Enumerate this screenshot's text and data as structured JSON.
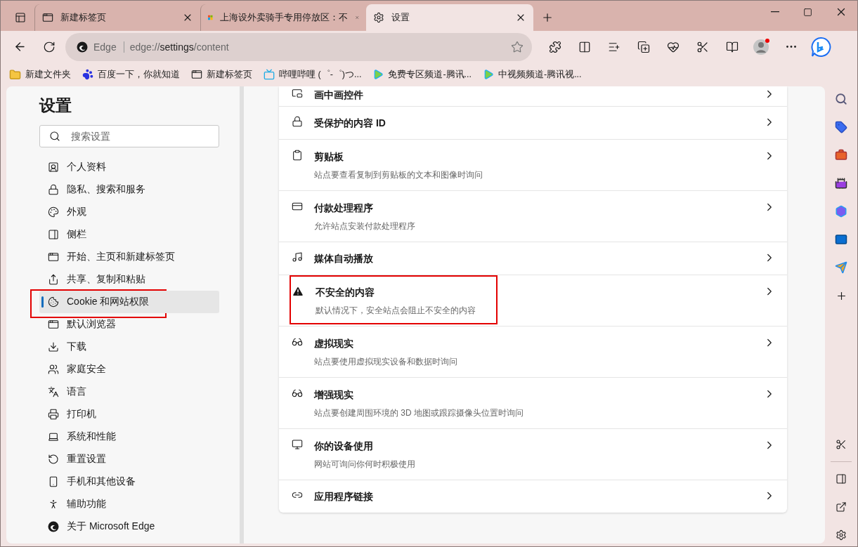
{
  "tabs": [
    {
      "label": "新建标签页",
      "selected": false
    },
    {
      "label": "上海设外卖骑手专用停放区：不",
      "selected": false
    },
    {
      "label": "设置",
      "selected": true
    }
  ],
  "address": {
    "site_label": "Edge",
    "url": "edge://**settings**/content"
  },
  "bookmarks": [
    {
      "label": "新建文件夹",
      "kind": "folder"
    },
    {
      "label": "百度一下，你就知道",
      "kind": "paw"
    },
    {
      "label": "新建标签页",
      "kind": "newtab"
    },
    {
      "label": "哔哩哔哩 (゜-゜)つ...",
      "kind": "tv"
    },
    {
      "label": "免费专区频道-腾讯...",
      "kind": "play"
    },
    {
      "label": "中视频频道-腾讯视...",
      "kind": "play"
    }
  ],
  "settings_title": "设置",
  "search": {
    "placeholder": "搜索设置"
  },
  "nav": [
    {
      "label": "个人资料",
      "selected": false,
      "highlighted": false
    },
    {
      "label": "隐私、搜索和服务",
      "selected": false,
      "highlighted": false
    },
    {
      "label": "外观",
      "selected": false,
      "highlighted": false
    },
    {
      "label": "侧栏",
      "selected": false,
      "highlighted": false
    },
    {
      "label": "开始、主页和新建标签页",
      "selected": false,
      "highlighted": false
    },
    {
      "label": "共享、复制和粘贴",
      "selected": false,
      "highlighted": false
    },
    {
      "label": "Cookie 和网站权限",
      "selected": true,
      "highlighted": true
    },
    {
      "label": "默认浏览器",
      "selected": false,
      "highlighted": false
    },
    {
      "label": "下载",
      "selected": false,
      "highlighted": false
    },
    {
      "label": "家庭安全",
      "selected": false,
      "highlighted": false
    },
    {
      "label": "语言",
      "selected": false,
      "highlighted": false
    },
    {
      "label": "打印机",
      "selected": false,
      "highlighted": false
    },
    {
      "label": "系统和性能",
      "selected": false,
      "highlighted": false
    },
    {
      "label": "重置设置",
      "selected": false,
      "highlighted": false
    },
    {
      "label": "手机和其他设备",
      "selected": false,
      "highlighted": false
    },
    {
      "label": "辅助功能",
      "selected": false,
      "highlighted": false
    },
    {
      "label": "关于 Microsoft Edge",
      "selected": false,
      "highlighted": false
    }
  ],
  "rows": [
    {
      "title": "画中画控件",
      "highlighted": false
    },
    {
      "title": "受保护的内容 ID",
      "highlighted": false
    },
    {
      "title": "剪贴板",
      "description": "站点要查看复制到剪贴板的文本和图像时询问",
      "highlighted": false
    },
    {
      "title": "付款处理程序",
      "description": "允许站点安装付款处理程序",
      "highlighted": false
    },
    {
      "title": "媒体自动播放",
      "highlighted": false
    },
    {
      "title": "不安全的内容",
      "description": "默认情况下，安全站点会阻止不安全的内容",
      "highlighted": true
    },
    {
      "title": "虚拟现实",
      "description": "站点要使用虚拟现实设备和数据时询问",
      "highlighted": false
    },
    {
      "title": "增强现实",
      "description": "站点要创建周围环境的 3D 地图或跟踪摄像头位置时询问",
      "highlighted": false
    },
    {
      "title": "你的设备使用",
      "description": "网站可询问你何时积极使用",
      "highlighted": false
    },
    {
      "title": "应用程序链接",
      "highlighted": false
    }
  ]
}
